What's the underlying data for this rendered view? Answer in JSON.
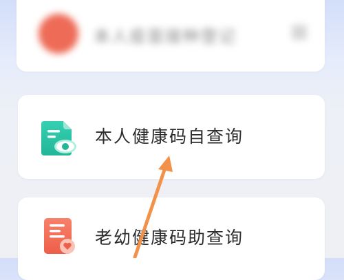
{
  "top_card": {
    "blurred_label": "本人疫苗接种登记"
  },
  "menu": {
    "self_query": {
      "label": "本人健康码自查询",
      "icon": "document-eye-icon",
      "color": "#2ec4a5"
    },
    "elder_child_query": {
      "label": "老幼健康码助查询",
      "icon": "document-heart-icon",
      "color": "#f26b55"
    }
  },
  "annotation": {
    "arrow_color": "#f2924a"
  }
}
